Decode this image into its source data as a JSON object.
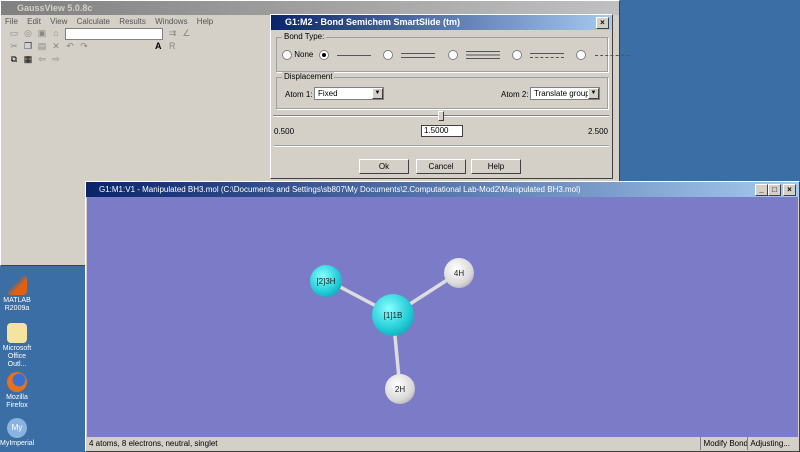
{
  "main_window": {
    "title": "GaussView 5.0.8c",
    "menu": [
      "File",
      "Edit",
      "View",
      "Calculate",
      "Results",
      "Windows",
      "Help"
    ]
  },
  "dialog": {
    "title": "G1:M2 - Bond Semichem SmartSlide (tm)",
    "bond_type_label": "Bond Type:",
    "none_label": "None",
    "displacement_label": "Displacement",
    "atom1_label": "Atom 1:",
    "atom1_value": "Fixed",
    "atom2_label": "Atom 2:",
    "atom2_value": "Translate group",
    "slider_min": "0.500",
    "slider_max": "2.500",
    "slider_value": "1.5000",
    "slider_fraction": 0.5,
    "ok": "Ok",
    "cancel": "Cancel",
    "help": "Help"
  },
  "viewer": {
    "title": "G1:M1:V1 - Manipulated BH3.mol (C:\\Documents and Settings\\sb807\\My Documents\\2.Computational Lab-Mod2\\Manipulated BH3.mol)",
    "atoms": {
      "b": "[1]1B",
      "h3": "[2]3H",
      "h4": "4H",
      "h2": "2H"
    },
    "status": "4 atoms, 8 electrons, neutral, singlet",
    "status_mode": "Modify Bond",
    "status_state": "Adjusting..."
  },
  "desktop": [
    {
      "label": "MATLAB R2009a"
    },
    {
      "label": "Microsoft Office Outl..."
    },
    {
      "label": "Mozilla Firefox"
    },
    {
      "label": "MyImperial"
    }
  ],
  "colors": {
    "desktop": "#3a6ea5",
    "canvas": "#7b7bc8",
    "boron": "#22d3dd",
    "hydrogen": "#e0e0e0"
  }
}
